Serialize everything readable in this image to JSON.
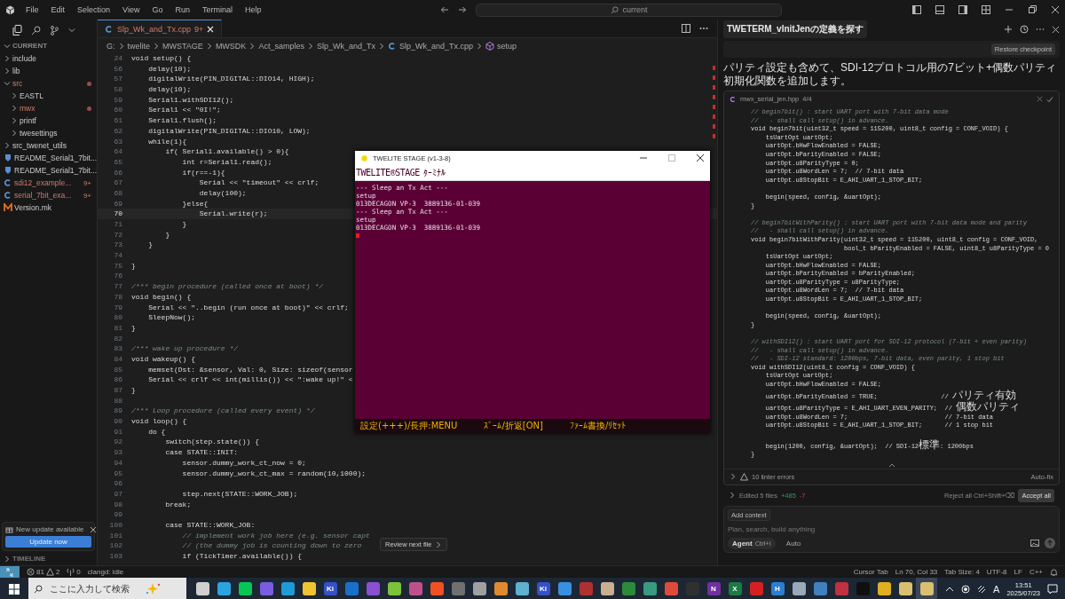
{
  "menu": [
    "File",
    "Edit",
    "Selection",
    "View",
    "Go",
    "Run",
    "Terminal",
    "Help"
  ],
  "command_center": {
    "label": "current"
  },
  "sidebar": {
    "section": "CURRENT",
    "items": [
      {
        "label": "include",
        "kind": "folder",
        "expanded": false,
        "modified": false
      },
      {
        "label": "lib",
        "kind": "folder",
        "expanded": false,
        "modified": false
      },
      {
        "label": "src",
        "kind": "folder",
        "expanded": true,
        "modified": true,
        "children": [
          {
            "label": "EASTL",
            "kind": "folder",
            "expanded": false,
            "modified": false
          },
          {
            "label": "mwx",
            "kind": "folder",
            "expanded": false,
            "modified": true
          },
          {
            "label": "printf",
            "kind": "folder",
            "expanded": false,
            "modified": false
          },
          {
            "label": "twesettings",
            "kind": "folder",
            "expanded": false,
            "modified": false
          }
        ]
      },
      {
        "label": "src_twenet_utils",
        "kind": "folder",
        "expanded": false,
        "modified": false
      },
      {
        "label": "README_Serial1_7bit...",
        "kind": "readme",
        "modified": false
      },
      {
        "label": "README_Serial1_7bit...",
        "kind": "readme",
        "modified": false
      },
      {
        "label": "sdi12_example...",
        "kind": "cpp",
        "modified": true,
        "badge": "9+"
      },
      {
        "label": "serial_7bit_exa...",
        "kind": "cpp",
        "modified": true,
        "badge": "9+"
      },
      {
        "label": "Version.mk",
        "kind": "make",
        "modified": false
      }
    ],
    "notification": {
      "title": "New update available",
      "button": "Update now"
    },
    "timeline": "TIMELINE"
  },
  "editor": {
    "tab": {
      "label": "Slp_Wk_and_Tx.cpp",
      "badge": "9+",
      "selected": true
    },
    "breadcrumbs": [
      "G:",
      "twelite",
      "MWSTAGE",
      "MWSDK",
      "Act_samples",
      "Slp_Wk_and_Tx",
      "Slp_Wk_and_Tx.cpp",
      "setup"
    ],
    "lines": [
      {
        "number": "24",
        "kind": "code",
        "text": "void setup() {",
        "current": false
      },
      {
        "number": "56",
        "kind": "code",
        "text": "    delay(10);",
        "current": false
      },
      {
        "number": "57",
        "kind": "code",
        "text": "    digitalWrite(PIN_DIGITAL::DIO14, HIGH);",
        "current": false
      },
      {
        "number": "58",
        "kind": "code",
        "text": "    delay(10);",
        "current": false
      },
      {
        "number": "59",
        "kind": "code",
        "text": "    Serial1.withSDI12();",
        "current": false
      },
      {
        "number": "60",
        "kind": "code",
        "text": "    Serial1 << \"0I!\";",
        "current": false
      },
      {
        "number": "61",
        "kind": "code",
        "text": "    Serial1.flush();",
        "current": false
      },
      {
        "number": "62",
        "kind": "code",
        "text": "    digitalWrite(PIN_DIGITAL::DIO10, LOW);",
        "current": false
      },
      {
        "number": "63",
        "kind": "code",
        "text": "    while(1){",
        "current": false
      },
      {
        "number": "64",
        "kind": "code",
        "text": "        if( Serial1.available() > 0){",
        "current": false
      },
      {
        "number": "65",
        "kind": "code",
        "text": "            int r=Serial1.read();",
        "current": false
      },
      {
        "number": "66",
        "kind": "code",
        "text": "            if(r==-1){",
        "current": false
      },
      {
        "number": "67",
        "kind": "code",
        "text": "                Serial << \"timeout\" << crlf;",
        "current": false
      },
      {
        "number": "68",
        "kind": "code",
        "text": "                delay(100);",
        "current": false
      },
      {
        "number": "69",
        "kind": "code",
        "text": "            }else{",
        "current": false
      },
      {
        "number": "70",
        "kind": "code",
        "text": "                Serial.write(r);",
        "current": true
      },
      {
        "number": "71",
        "kind": "code",
        "text": "            }",
        "current": false
      },
      {
        "number": "72",
        "kind": "code",
        "text": "        }",
        "current": false
      },
      {
        "number": "73",
        "kind": "code",
        "text": "    }",
        "current": false
      },
      {
        "number": "74",
        "kind": "blank",
        "current": false
      },
      {
        "number": "75",
        "kind": "code",
        "text": "}",
        "current": false
      },
      {
        "number": "76",
        "kind": "blank",
        "current": false
      },
      {
        "number": "77",
        "kind": "comment",
        "text": "/*** begin procedure (called once at boot) */",
        "current": false
      },
      {
        "number": "78",
        "kind": "code",
        "text": "void begin() {",
        "current": false
      },
      {
        "number": "79",
        "kind": "code",
        "text": "    Serial << \"..begin (run once at boot)\" << crlf;",
        "current": false
      },
      {
        "number": "80",
        "kind": "code",
        "text": "    SleepNow();",
        "current": false
      },
      {
        "number": "81",
        "kind": "code",
        "text": "}",
        "current": false
      },
      {
        "number": "82",
        "kind": "blank",
        "current": false
      },
      {
        "number": "83",
        "kind": "comment",
        "text": "/*** wake up procedure */",
        "current": false
      },
      {
        "number": "84",
        "kind": "code",
        "text": "void wakeup() {",
        "current": false
      },
      {
        "number": "85",
        "kind": "code",
        "text": "    memset(Dst: &sensor, Val: 0, Size: sizeof(sensor",
        "current": false
      },
      {
        "number": "86",
        "kind": "code",
        "text": "    Serial << crlf << int(millis()) << \":wake up!\" <",
        "current": false
      },
      {
        "number": "87",
        "kind": "code",
        "text": "}",
        "current": false
      },
      {
        "number": "88",
        "kind": "blank",
        "current": false
      },
      {
        "number": "89",
        "kind": "comment",
        "text": "/*** Loop procedure (called every event) */",
        "current": false
      },
      {
        "number": "90",
        "kind": "code",
        "text": "void loop() {",
        "current": false
      },
      {
        "number": "91",
        "kind": "code",
        "text": "    do {",
        "current": false
      },
      {
        "number": "92",
        "kind": "code",
        "text": "        switch(step.state()) {",
        "current": false
      },
      {
        "number": "93",
        "kind": "code",
        "text": "        case STATE::INIT:",
        "current": false
      },
      {
        "number": "94",
        "kind": "code",
        "text": "            sensor.dummy_work_ct_now = 0;",
        "current": false
      },
      {
        "number": "95",
        "kind": "code",
        "text": "            sensor.dummy_work_ct_max = random(10,1000);",
        "current": false
      },
      {
        "number": "96",
        "kind": "blank",
        "current": false
      },
      {
        "number": "97",
        "kind": "code",
        "text": "            step.next(STATE::WORK_JOB);",
        "current": false
      },
      {
        "number": "98",
        "kind": "code",
        "text": "        break;",
        "current": false
      },
      {
        "number": "99",
        "kind": "blank",
        "current": false
      },
      {
        "number": "100",
        "kind": "code",
        "text": "        case STATE::WORK_JOB:",
        "current": false
      },
      {
        "number": "101",
        "kind": "comment",
        "text": "            // implement work job here (e.g. sensor capt",
        "current": false
      },
      {
        "number": "102",
        "kind": "comment",
        "text": "            // (the dummy job is counting down to zero",
        "current": false
      },
      {
        "number": "103",
        "kind": "code",
        "text": "            if (TickTimer.available()) {",
        "current": false
      }
    ],
    "tooltip": "Review next file"
  },
  "terminal_window": {
    "title": "TWELITE STAGE (v1-3-8)",
    "brand": "TWELITE®STAGE",
    "subtitle": "ﾀｰﾐﾅﾙ",
    "lines": [
      "--- Sleep an Tx Act ---",
      "setup",
      "013DECAGON VP-3  3889136-01-039",
      "--- Sleep an Tx Act ---",
      "setup",
      "013DECAGON VP-3  3889136-01-039"
    ],
    "footer": [
      "設定(+++)/長押:MENU",
      "ｽﾞｰﾑ/折返[ON]",
      "ﾌｧｰﾑ書換/ﾘｾｯﾄ"
    ]
  },
  "chat": {
    "title": "TWETERM_vInitJenの定義を探す",
    "restore": "Restore checkpoint",
    "message": "パリティ設定も含めて、SDI-12プロトコル用の7ビット+偶数パリティ初期化関数を追加します。",
    "file": {
      "name": "mwx_serial_jen.hpp",
      "count": "4/4",
      "lines": [
        {
          "kind": "comment",
          "text": "// begin7bit() : start UART port with 7-bit data mode"
        },
        {
          "kind": "comment",
          "text": "//   - shall call setup() in advance."
        },
        {
          "kind": "code",
          "text": "void begin7bit(uint32_t speed = 115200, uint8_t config = CONF_VOID) {"
        },
        {
          "kind": "code",
          "text": "    tsUartOpt uartOpt;"
        },
        {
          "kind": "code",
          "text": "    uartOpt.bHwFlowEnabled = FALSE;"
        },
        {
          "kind": "code",
          "text": "    uartOpt.bParityEnabled = FALSE;"
        },
        {
          "kind": "code",
          "text": "    uartOpt.u8ParityType = 0;"
        },
        {
          "kind": "code",
          "text": "    uartOpt.u8WordLen = 7;  // 7-bit data"
        },
        {
          "kind": "code",
          "text": "    uartOpt.u8StopBit = E_AHI_UART_1_STOP_BIT;"
        },
        {
          "kind": "blank"
        },
        {
          "kind": "code",
          "text": "    begin(speed, config, &uartOpt);"
        },
        {
          "kind": "code",
          "text": "}"
        },
        {
          "kind": "blank"
        },
        {
          "kind": "comment",
          "text": "// begin7bitWithParity() : start UART port with 7-bit data mode and parity"
        },
        {
          "kind": "comment",
          "text": "//   - shall call setup() in advance."
        },
        {
          "kind": "code",
          "text": "void begin7bitWithParity(uint32_t speed = 115200, uint8_t config = CONF_VOID,"
        },
        {
          "kind": "code",
          "text": "                         bool_t bParityEnabled = FALSE, uint8_t u8ParityType = 0"
        },
        {
          "kind": "code",
          "text": "    tsUartOpt uartOpt;"
        },
        {
          "kind": "code",
          "text": "    uartOpt.bHwFlowEnabled = FALSE;"
        },
        {
          "kind": "code",
          "text": "    uartOpt.bParityEnabled = bParityEnabled;"
        },
        {
          "kind": "code",
          "text": "    uartOpt.u8ParityType = u8ParityType;"
        },
        {
          "kind": "code",
          "text": "    uartOpt.u8WordLen = 7;  // 7-bit data"
        },
        {
          "kind": "code",
          "text": "    uartOpt.u8StopBit = E_AHI_UART_1_STOP_BIT;"
        },
        {
          "kind": "blank"
        },
        {
          "kind": "code",
          "text": "    begin(speed, config, &uartOpt);"
        },
        {
          "kind": "code",
          "text": "}"
        },
        {
          "kind": "blank"
        },
        {
          "kind": "comment",
          "text": "// withSDI12() : start UART port for SDI-12 protocol (7-bit + even parity)"
        },
        {
          "kind": "comment",
          "text": "//   - shall call setup() in advance."
        },
        {
          "kind": "comment",
          "text": "//   - SDI-12 standard: 1200bps, 7-bit data, even parity, 1 stop bit"
        },
        {
          "kind": "code",
          "text": "void withSDI12(uint8_t config = CONF_VOID) {"
        },
        {
          "kind": "code",
          "text": "    tsUartOpt uartOpt;"
        },
        {
          "kind": "code",
          "text": "    uartOpt.bHwFlowEnabled = FALSE;"
        },
        {
          "kind": "code",
          "text": "    uartOpt.bParityEnabled = TRUE;                 // パリティ有効"
        },
        {
          "kind": "code",
          "text": "    uartOpt.u8ParityType = E_AHI_UART_EVEN_PARITY;  // 偶数パリティ"
        },
        {
          "kind": "code",
          "text": "    uartOpt.u8WordLen = 7;                          // 7-bit data"
        },
        {
          "kind": "code",
          "text": "    uartOpt.u8StopBit = E_AHI_UART_1_STOP_BIT;      // 1 stop bit"
        },
        {
          "kind": "blank"
        },
        {
          "kind": "code",
          "text": "    begin(1200, config, &uartOpt);  // SDI-12標準: 1200bps"
        },
        {
          "kind": "code",
          "text": "}"
        }
      ]
    },
    "linter": "10 linter errors",
    "autofix": "Auto-fix",
    "edited": {
      "label": "Edited 5 files",
      "added": "+485",
      "removed": "-7",
      "reject": "Reject all Ctrl+Shift+⌫",
      "accept": "Accept all"
    },
    "add_context": "Add context",
    "placeholder": "Plan, search, build anything",
    "mode": {
      "label": "Agent",
      "shortcut": "Ctrl+I"
    },
    "model": "Auto"
  },
  "status_bar": {
    "errors": "81",
    "warnings": "2",
    "ports": "0",
    "server": "clangd: idle",
    "right": [
      "Cursor Tab",
      "Ln 70, Col 33",
      "Tab Size: 4",
      "UTF-8",
      "LF",
      "C++"
    ]
  },
  "taskbar": {
    "search": {
      "placeholder": "ここに入力して検索"
    },
    "apps": [
      {
        "color": "#d0d0d0",
        "selected": false
      },
      {
        "color": "#2aa3e0",
        "selected": false
      },
      {
        "color": "#06c755",
        "selected": false
      },
      {
        "color": "#7a5ce0",
        "selected": false
      },
      {
        "color": "#1f9ad6",
        "selected": false
      },
      {
        "color": "#f2c230",
        "selected": false
      },
      {
        "color": "#3550c8",
        "label": "Ki",
        "selected": false
      },
      {
        "color": "#1a70c8",
        "selected": false
      },
      {
        "color": "#8a50d0",
        "selected": false
      },
      {
        "color": "#7cc23a",
        "selected": false
      },
      {
        "color": "#c0508a",
        "selected": false
      },
      {
        "color": "#f25022",
        "selected": false
      },
      {
        "color": "#707070",
        "selected": false
      },
      {
        "color": "#a0a0a0",
        "selected": false
      },
      {
        "color": "#e08a30",
        "selected": false
      },
      {
        "color": "#60b0d0",
        "selected": false
      },
      {
        "color": "#3550c8",
        "label": "Ki",
        "selected": false
      },
      {
        "color": "#3a90e0",
        "selected": false
      },
      {
        "color": "#b03030",
        "selected": false
      },
      {
        "color": "#c8b090",
        "selected": false
      },
      {
        "color": "#2c8a3a",
        "selected": false
      },
      {
        "color": "#3a9a80",
        "selected": false
      },
      {
        "color": "#e04a3a",
        "selected": false
      },
      {
        "color": "#303030",
        "selected": false
      },
      {
        "color": "#7030a0",
        "label": "N",
        "selected": false
      },
      {
        "color": "#1d7a45",
        "label": "X",
        "selected": false
      },
      {
        "color": "#d42020",
        "selected": false
      },
      {
        "color": "#2a80d0",
        "label": "H",
        "selected": false
      },
      {
        "color": "#9aa8b8",
        "selected": false
      },
      {
        "color": "#4080c0",
        "selected": false
      },
      {
        "color": "#c03040",
        "selected": false
      },
      {
        "color": "#101010",
        "selected": false
      },
      {
        "color": "#e0b020",
        "selected": false
      },
      {
        "color": "#d8c070",
        "selected": false
      },
      {
        "color": "#d8c070",
        "selected": true
      }
    ],
    "ime": "A",
    "time": "13:51",
    "date": "2025/07/23"
  }
}
